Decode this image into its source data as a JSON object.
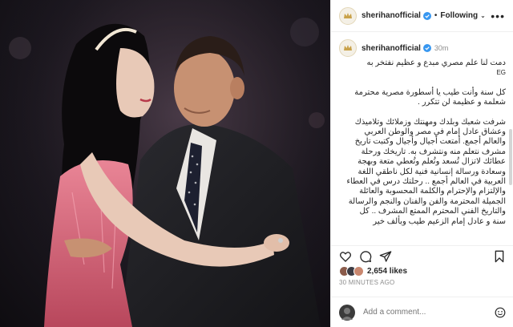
{
  "post": {
    "username": "sherihanofficial",
    "follow_state": "Following",
    "more_label": "•••",
    "chevron": "⌄"
  },
  "caption": {
    "username": "sherihanofficial",
    "time": "30m",
    "paragraphs": [
      "دمت لنا علم مصري مبدع و عظيم نفتخر به",
      "كل سنة وأنت طيب يا أسطورة مصرية محترمة شعلمة و عظيمة لن تتكرر .",
      "شرفت شعبك وبلدك ومهنتك وزملائك وتلاميذك وعشاق عادل إمام في مصر والوطن العربي والعالم أجمع. أمتعت أجيال وأجيال وكتبت تاريخ مشرف نتعلم منه ونتشرف به. تاريخك ورحلة عطائك لاتزال تُسعد وتُعلم وتُعطي متعة وبهجة وسعادة ورسالة إنسانية فنية لكل ناطقي اللغة العربية في العالم أجمع .. رحلتك درس في العطاء والإلتزام والإحترام والكلمة المحسوبة والعائلة الجميلة المحترمة والفن والفنان والنجم والرسالة والتاريخ الفني المحترم الممتع المشرف .. كل سنة و عادل إمام الزعيم طيب وبألف خير"
    ],
    "flag_text": "EG"
  },
  "actions": {
    "like_icon": "heart-icon",
    "comment_icon": "comment-icon",
    "share_icon": "share-icon",
    "save_icon": "bookmark-icon"
  },
  "likes": {
    "count_text": "2,654 likes",
    "time_ago": "30 MINUTES AGO"
  },
  "comment": {
    "placeholder": "Add a comment..."
  },
  "colors": {
    "verified": "#3897f0",
    "text": "#262626",
    "muted": "#8e8e8e",
    "gown": "#d9657a"
  }
}
